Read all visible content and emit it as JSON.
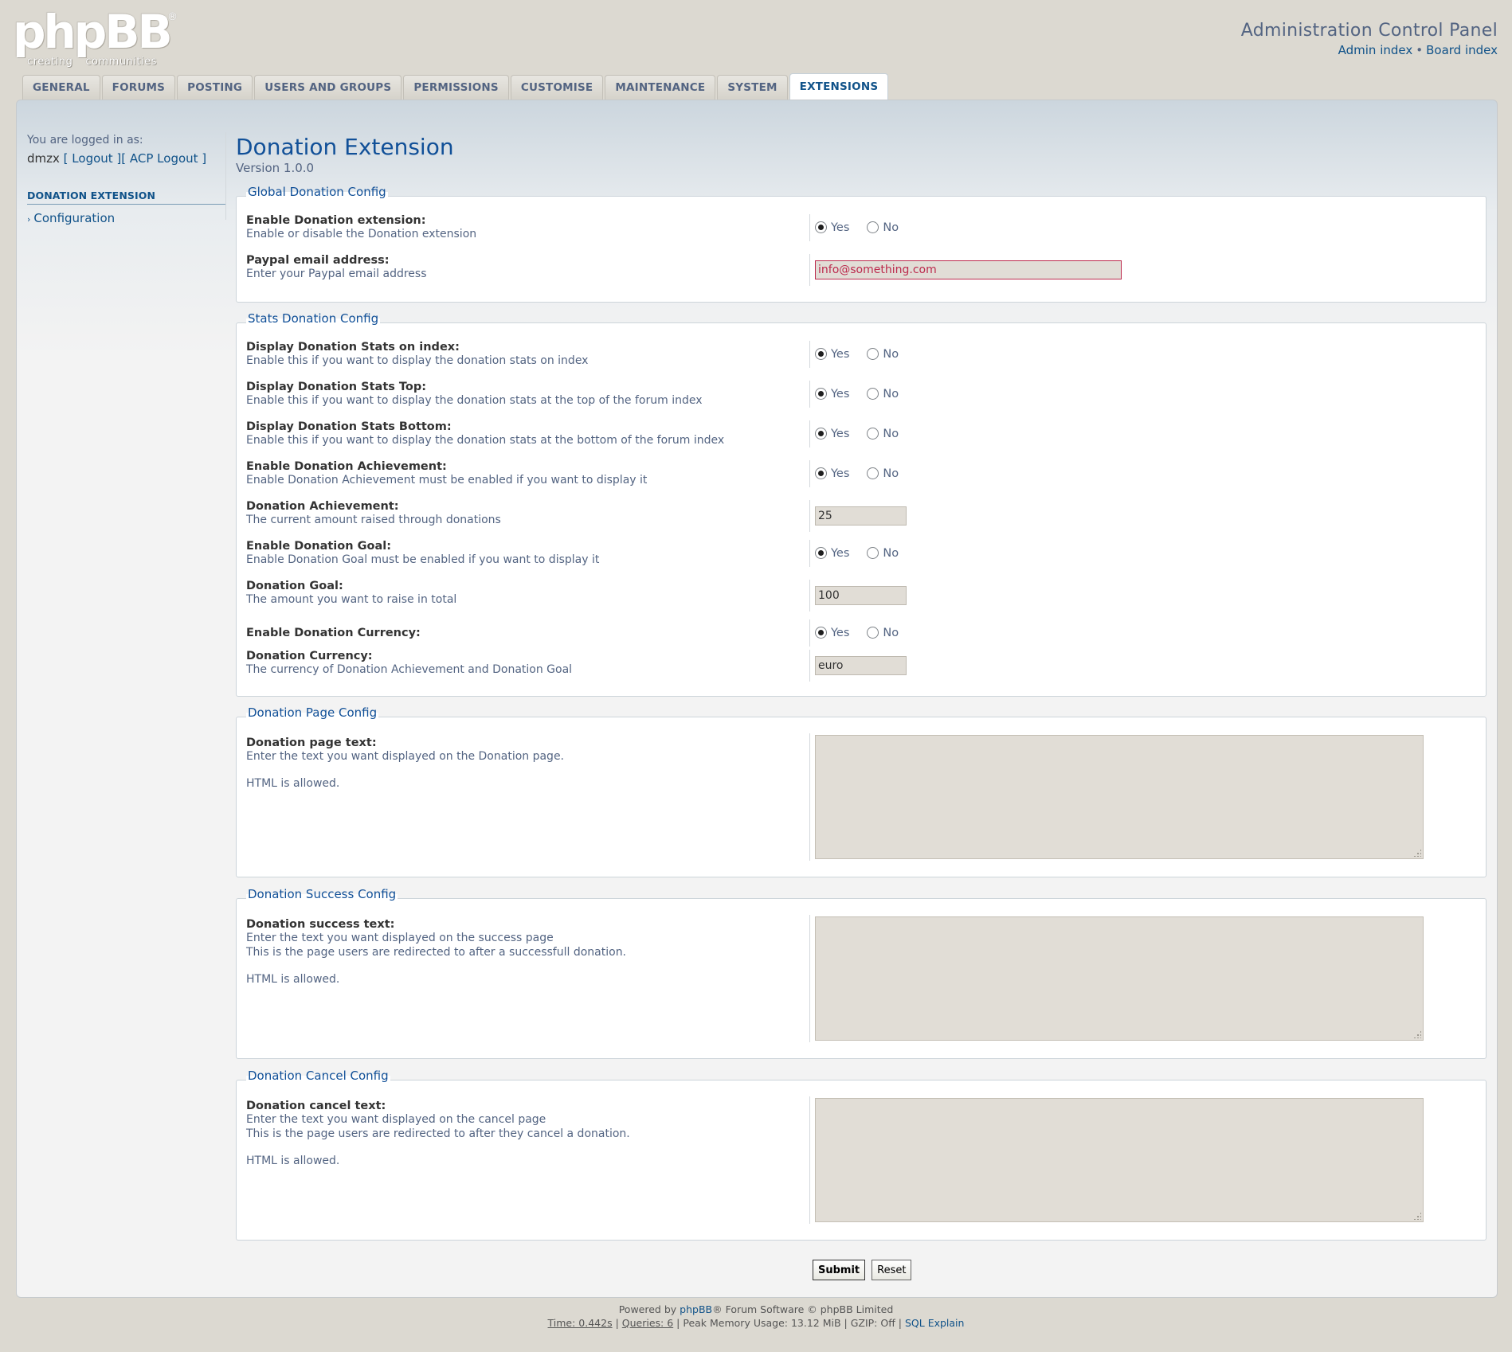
{
  "logo": {
    "word": "phpBB",
    "reg": "®",
    "tag1": "creating",
    "tag2": "communities"
  },
  "header": {
    "title": "Administration Control Panel",
    "admin_index": "Admin index",
    "separator": "•",
    "board_index": "Board index"
  },
  "tabs": [
    "General",
    "Forums",
    "Posting",
    "Users and Groups",
    "Permissions",
    "Customise",
    "Maintenance",
    "System",
    "Extensions"
  ],
  "active_tab": "Extensions",
  "sidebar": {
    "logged_in_as": "You are logged in as:",
    "username": "dmzx",
    "logout": "[ Logout ]",
    "acp_logout": "[ ACP Logout ]",
    "menu_heading": "Donation Extension",
    "menu_item": "Configuration"
  },
  "page": {
    "title": "Donation Extension",
    "version": "Version 1.0.0"
  },
  "radio": {
    "yes": "Yes",
    "no": "No"
  },
  "global": {
    "legend": "Global Donation Config",
    "enable_title": "Enable Donation extension:",
    "enable_desc": "Enable or disable the Donation extension",
    "paypal_title": "Paypal email address:",
    "paypal_desc": "Enter your Paypal email address",
    "paypal_value": "info@something.com"
  },
  "stats": {
    "legend": "Stats Donation Config",
    "index_title": "Display Donation Stats on index:",
    "index_desc": "Enable this if you want to display the donation stats on index",
    "top_title": "Display Donation Stats Top:",
    "top_desc": "Enable this if you want to display the donation stats at the top of the forum index",
    "bottom_title": "Display Donation Stats Bottom:",
    "bottom_desc": "Enable this if you want to display the donation stats at the bottom of the forum index",
    "ach_en_title": "Enable Donation Achievement:",
    "ach_en_desc": "Enable Donation Achievement must be enabled if you want to display it",
    "ach_title": "Donation Achievement:",
    "ach_desc": "The current amount raised through donations",
    "ach_value": "25",
    "goal_en_title": "Enable Donation Goal:",
    "goal_en_desc": "Enable Donation Goal must be enabled if you want to display it",
    "goal_title": "Donation Goal:",
    "goal_desc": "The amount you want to raise in total",
    "goal_value": "100",
    "cur_en_title": "Enable Donation Currency:",
    "cur_title": "Donation Currency:",
    "cur_desc": "The currency of Donation Achievement and Donation Goal",
    "cur_value": "euro"
  },
  "page_config": {
    "legend": "Donation Page Config",
    "title": "Donation page text:",
    "desc1": "Enter the text you want displayed on the Donation page.",
    "html": "HTML is allowed."
  },
  "success_config": {
    "legend": "Donation Success Config",
    "title": "Donation success text:",
    "desc1": "Enter the text you want displayed on the success page",
    "desc2": "This is the page users are redirected to after a successfull donation.",
    "html": "HTML is allowed."
  },
  "cancel_config": {
    "legend": "Donation Cancel Config",
    "title": "Donation cancel text:",
    "desc1": "Enter the text you want displayed on the cancel page",
    "desc2": "This is the page users are redirected to after they cancel a donation.",
    "html": "HTML is allowed."
  },
  "buttons": {
    "submit": "Submit",
    "reset": "Reset"
  },
  "footer": {
    "powered_pre": "Powered by",
    "powered_link": "phpBB",
    "powered_post": "® Forum Software © phpBB Limited",
    "time": "Time: 0.442s",
    "queries": "Queries: 6",
    "mem": "| Peak Memory Usage: 13.12 MiB | GZIP: Off |",
    "sql": "SQL Explain"
  }
}
